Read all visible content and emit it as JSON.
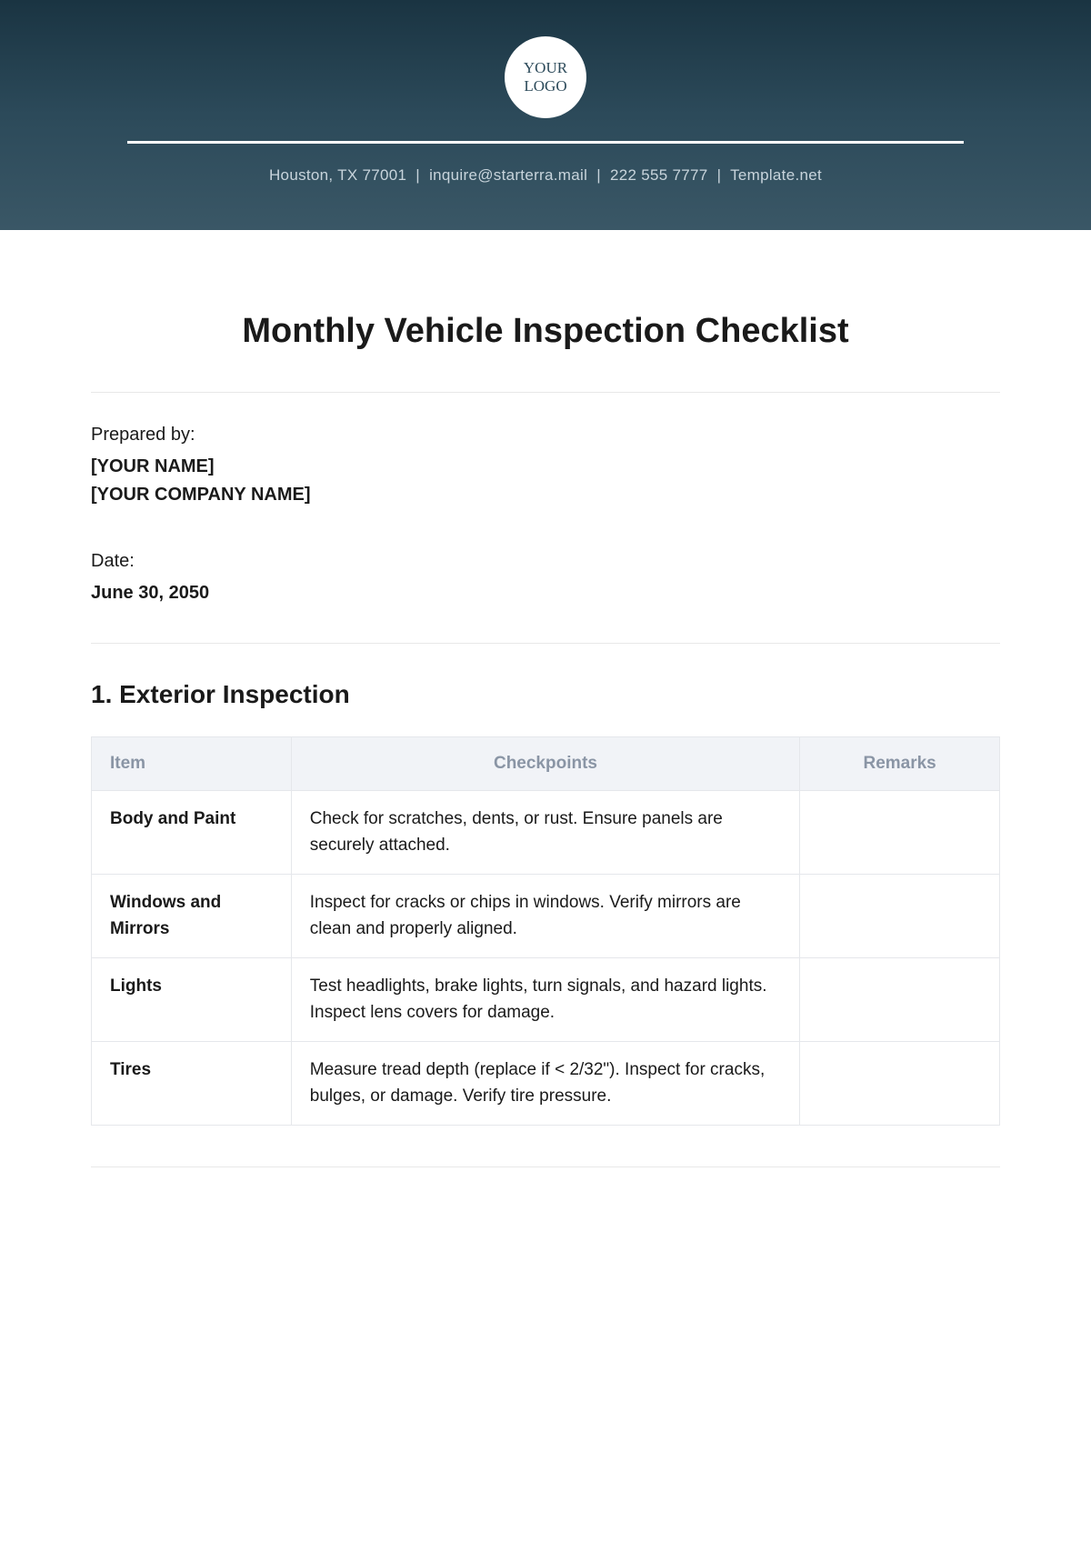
{
  "header": {
    "logo_line1": "YOUR",
    "logo_line2": "LOGO",
    "location": "Houston, TX 77001",
    "email": "inquire@starterra.mail",
    "phone": "222 555 7777",
    "site": "Template.net"
  },
  "title": "Monthly Vehicle Inspection Checklist",
  "prepared_by": {
    "label": "Prepared by:",
    "name": "[YOUR NAME]",
    "company": "[YOUR COMPANY NAME]"
  },
  "date": {
    "label": "Date:",
    "value": "June 30, 2050"
  },
  "section1": {
    "heading": "1. Exterior Inspection",
    "columns": {
      "c1": "Item",
      "c2": "Checkpoints",
      "c3": "Remarks"
    },
    "rows": [
      {
        "item": "Body and Paint",
        "checkpoints": "Check for scratches, dents, or rust. Ensure panels are securely attached.",
        "remarks": ""
      },
      {
        "item": "Windows and Mirrors",
        "checkpoints": "Inspect for cracks or chips in windows. Verify mirrors are clean and properly aligned.",
        "remarks": ""
      },
      {
        "item": "Lights",
        "checkpoints": "Test headlights, brake lights, turn signals, and hazard lights. Inspect lens covers for damage.",
        "remarks": ""
      },
      {
        "item": "Tires",
        "checkpoints": "Measure tread depth (replace if < 2/32\"). Inspect for cracks, bulges, or damage. Verify tire pressure.",
        "remarks": ""
      }
    ]
  }
}
